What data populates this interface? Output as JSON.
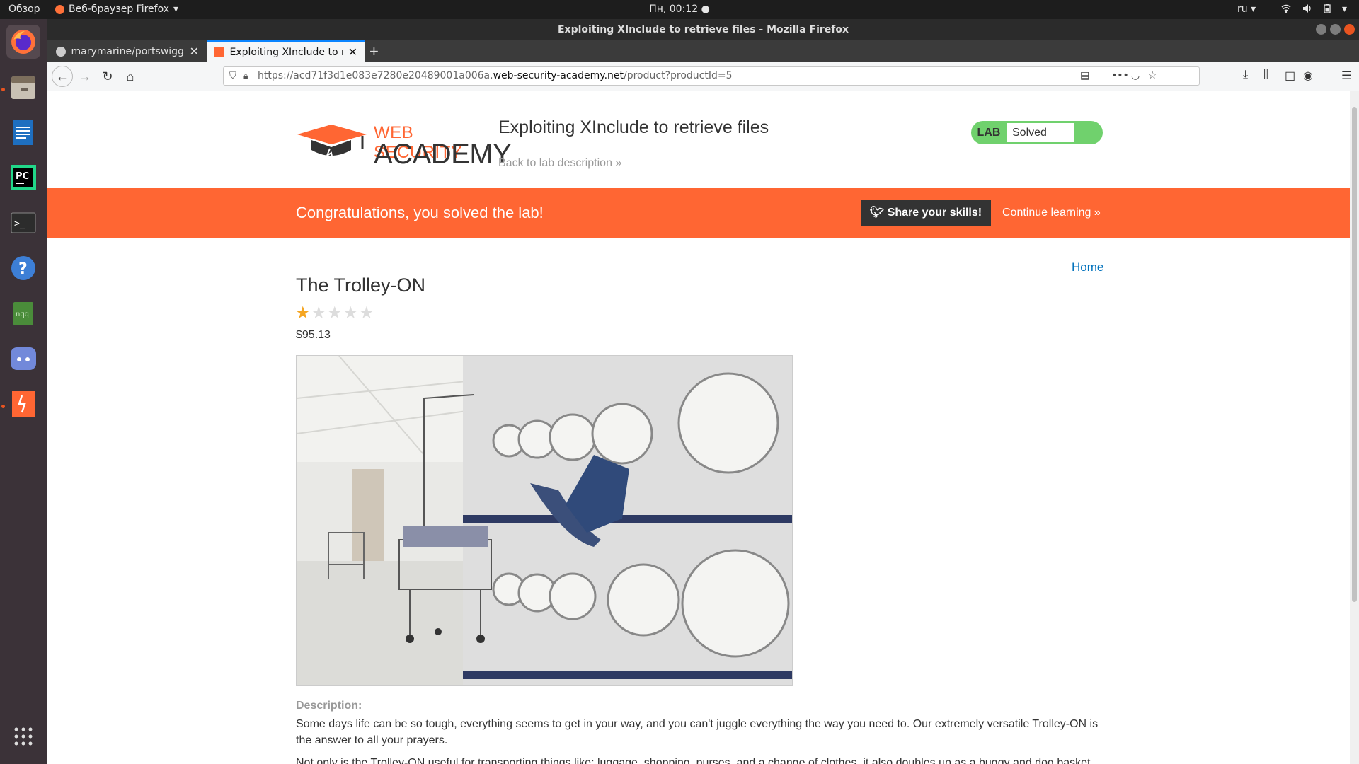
{
  "topbar": {
    "overview": "Обзор",
    "app_menu": "Веб-браузер Firefox",
    "clock": "Пн, 00:12",
    "lang": "ru"
  },
  "window": {
    "title": "Exploiting XInclude to retrieve files - Mozilla Firefox"
  },
  "tabs": [
    {
      "label": "marymarine/portswigger",
      "icon": "github-icon"
    },
    {
      "label": "Exploiting XInclude to retrieve files",
      "icon": "portswigger-icon"
    }
  ],
  "address": {
    "prefix": "https://acd71f3d1e083e7280e20489001a006a.",
    "domain": "web-security-academy.net",
    "path": "/product?productId=5"
  },
  "page": {
    "logo_top": "WEB SECURITY",
    "logo_bottom": "ACADEMY",
    "lab_title": "Exploiting XInclude to retrieve files",
    "back_link": "Back to lab description",
    "lab_badge": "LAB",
    "lab_status": "Solved",
    "banner_text": "Congratulations, you solved the lab!",
    "share_button": "Share your skills!",
    "continue_link": "Continue learning",
    "home_link": "Home",
    "product_name": "The Trolley-ON",
    "rating": 1,
    "rating_max": 5,
    "price": "$95.13",
    "description_label": "Description:",
    "description_p1": "Some days life can be so tough, everything seems to get in your way, and you can't juggle everything the way you need to. Our extremely versatile Trolley-ON is the answer to all your prayers.",
    "description_p2": "Not only is the Trolley-ON useful for transporting things like; luggage, shopping, purses, and a change of clothes, it also doubles up as a buggy and dog basket."
  },
  "colors": {
    "brand_orange": "#ff6633",
    "solved_green": "#70d16d",
    "link_blue": "#0071bc"
  }
}
